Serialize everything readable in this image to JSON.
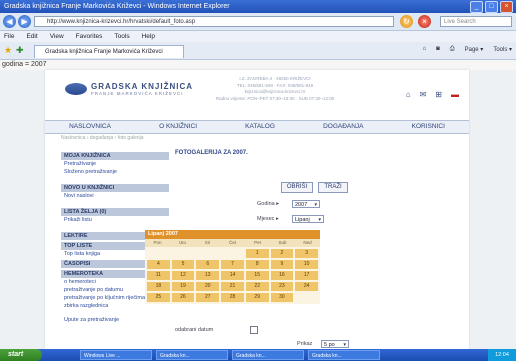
{
  "window": {
    "title": "Gradska knjižnica Franje Markovića Križevci - Windows Internet Explorer",
    "controls": [
      "_",
      "□",
      "×"
    ]
  },
  "address": {
    "url": "http://www.knjiznica-krizevci.hr/hrvatski/default_foto.asp",
    "search_placeholder": "Live Search"
  },
  "menu": [
    "File",
    "Edit",
    "View",
    "Favorites",
    "Tools",
    "Help"
  ],
  "tab": {
    "label": "Gradska knjižnica Franje Markovića Križevci"
  },
  "commandbar": [
    "Page ▾",
    "Tools ▾"
  ],
  "debug_text": "godina = 2007",
  "site": {
    "logo_title": "GRADSKA KNJIŽNICA",
    "logo_subtitle": "FRANJE MARKOVIĆA KRIŽEVCI",
    "contact_lines": [
      "I.Z. ZAGREBA 4 · 48260 KRIŽEVCI",
      "TEL: 048/681-948 · FAX: 048/681-948",
      "knjiznica@knjiznica-krizevci.hr",
      "Radno vrijeme: PON–PET 07:30–19:30 · SUB 07:30–13:00"
    ],
    "nav": [
      "NASLOVNICA",
      "O KNJIŽNICI",
      "KATALOG",
      "DOGAĐANJA",
      "KORISNICI"
    ],
    "breadcrumb": "Naslovnica › događanja › foto galerija",
    "sidebar": [
      {
        "header": "MOJA KNJIŽNICA",
        "items": [
          "Pretraživanje",
          "Složeno pretraživanje"
        ]
      },
      {
        "header": "NOVO U KNJIŽNICI",
        "items": [
          "Novi naslovi"
        ]
      },
      {
        "header": "LISTA ŽELJA (0)",
        "items": [
          "Prikaži listu"
        ]
      },
      {
        "header": "LEKTIRE",
        "items": []
      },
      {
        "header": "TOP LISTE",
        "items": [
          "Top lista knjiga"
        ]
      },
      {
        "header": "ČASOPISI",
        "items": []
      },
      {
        "header": "HEMEROTEKA",
        "items": [
          "o hemeroteci",
          "pretraživanje po datumu",
          "pretraživanje po ključnim riječima",
          "zbirka razglednica"
        ]
      }
    ],
    "content_title": "FOTOGALERIJA ZA 2007.",
    "buttons": {
      "clear": "OBRIŠI",
      "search": "TRAŽI"
    },
    "year_label": "Godina ▸",
    "year_value": "2007",
    "month_label": "Mjesec ▸",
    "month_value": "Lipanj",
    "calendar": {
      "title": "Lipanj 2007",
      "days": [
        "Pon",
        "Uto",
        "Sri",
        "Čet",
        "Pet",
        "Sub",
        "Ned"
      ],
      "cells": [
        "",
        "",
        "",
        "",
        "1",
        "2",
        "3",
        "4",
        "5",
        "6",
        "7",
        "8",
        "9",
        "10",
        "11",
        "12",
        "13",
        "14",
        "15",
        "16",
        "17",
        "18",
        "19",
        "20",
        "21",
        "22",
        "23",
        "24",
        "25",
        "26",
        "27",
        "28",
        "29",
        "30",
        ""
      ]
    },
    "shown_label": "odabrani datum",
    "bottom_link": "Upute za pretraživanje",
    "bottom_select_label": "Prikaz",
    "bottom_select_value": "5 po"
  },
  "taskbar": {
    "start": "start",
    "tasks": [
      "Windows Live ...",
      "Gradska kn...",
      "Gradska kn...",
      "Gradska kn..."
    ],
    "clock": "12:04"
  }
}
